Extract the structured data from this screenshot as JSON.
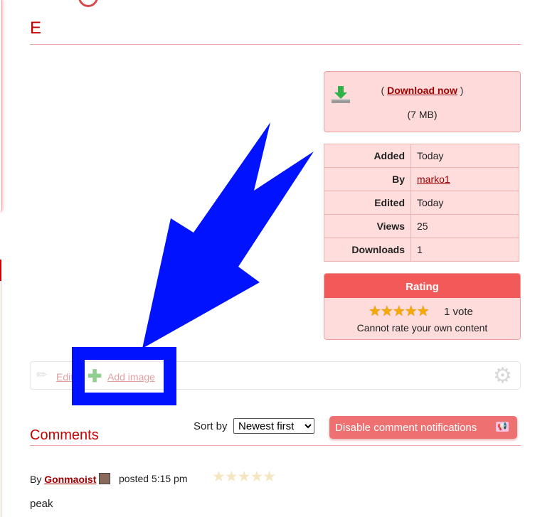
{
  "page": {
    "title": "E"
  },
  "download": {
    "paren_open": "(",
    "link_label": "Download now",
    "paren_close": ")",
    "size": "(7 MB)"
  },
  "info": {
    "rows": [
      {
        "key": "Added",
        "value": "Today"
      },
      {
        "key": "By",
        "value": "marko1"
      },
      {
        "key": "Edited",
        "value": "Today"
      },
      {
        "key": "Views",
        "value": "25"
      },
      {
        "key": "Downloads",
        "value": "1"
      }
    ]
  },
  "rating": {
    "heading": "Rating",
    "stars_display": "★★★★★",
    "stars": 5,
    "votes": "1 vote",
    "note": "Cannot rate your own content"
  },
  "toolbar": {
    "edit_label": "Edit",
    "add_image_label": "Add image"
  },
  "comments": {
    "title": "Comments",
    "sort_label": "Sort by",
    "sort_selected": "Newest first",
    "notif_button": "Disable comment notifications",
    "items": [
      {
        "by": "By",
        "user": "Gonmaoist",
        "time": "posted 5:15 pm",
        "stars_display": "★★★★★",
        "body": "peak"
      }
    ]
  },
  "colors": {
    "accent": "#c80000",
    "annotation": "#0012ff",
    "panel": "#ffdada"
  }
}
